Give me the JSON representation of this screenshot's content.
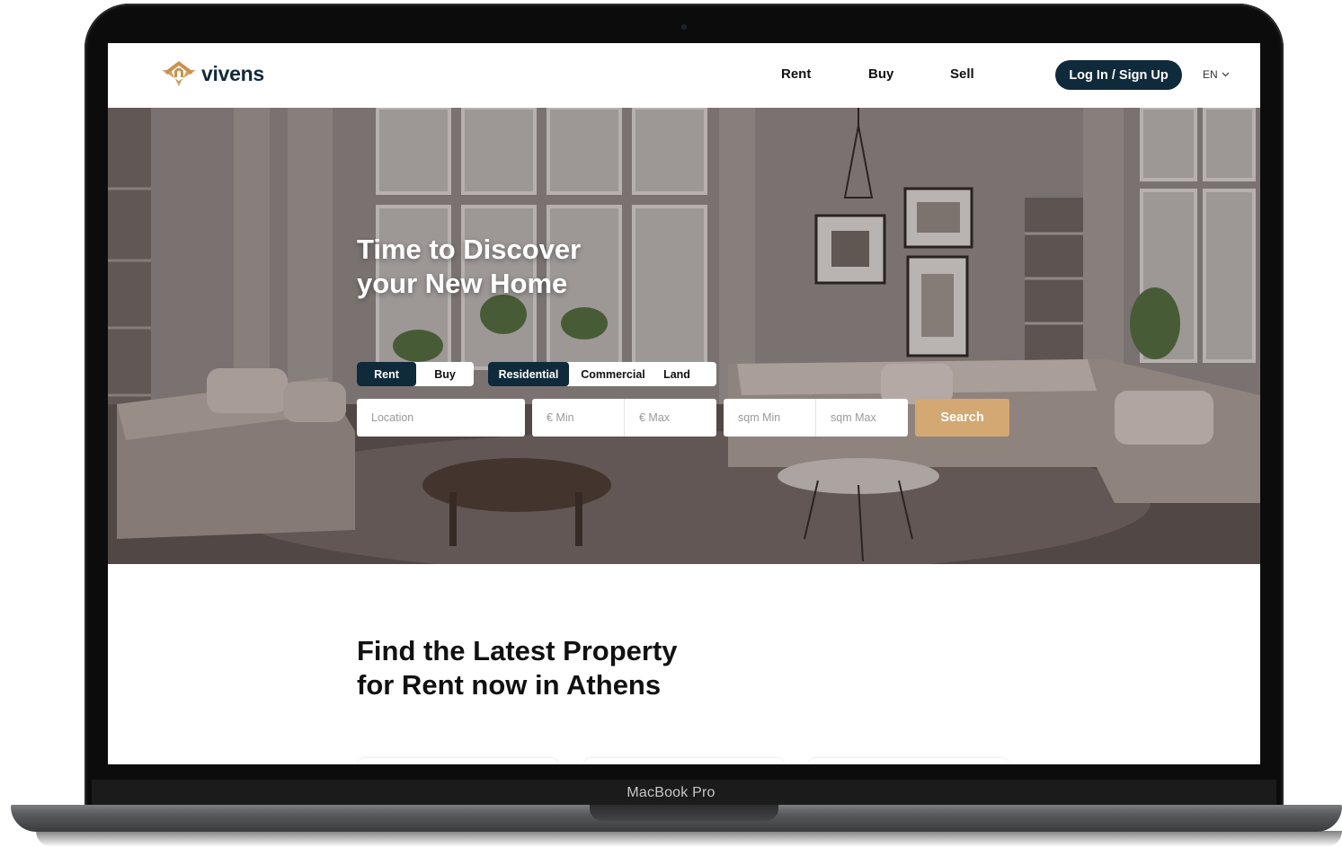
{
  "brand": {
    "name": "vivens"
  },
  "nav": {
    "links": [
      {
        "label": "Rent"
      },
      {
        "label": "Buy"
      },
      {
        "label": "Sell"
      }
    ],
    "login_label": "Log In / Sign Up",
    "language": "EN"
  },
  "hero": {
    "title_line1": "Time to Discover",
    "title_line2": "your New Home",
    "mode_toggle": [
      {
        "label": "Rent",
        "active": true
      },
      {
        "label": "Buy",
        "active": false
      }
    ],
    "type_toggle": [
      {
        "label": "Residential",
        "active": true
      },
      {
        "label": "Commercial",
        "active": false
      },
      {
        "label": "Land",
        "active": false
      }
    ],
    "search": {
      "location_placeholder": "Location",
      "price_min_placeholder": "€ Min",
      "price_max_placeholder": "€ Max",
      "sqm_min_placeholder": "sqm Min",
      "sqm_max_placeholder": "sqm Max",
      "search_label": "Search"
    }
  },
  "section": {
    "title_line1": "Find the Latest Property",
    "title_line2": "for Rent now in Athens"
  },
  "device": {
    "label": "MacBook Pro"
  },
  "colors": {
    "navy": "#0f2a3a",
    "gold": "#d3a873",
    "logo_gold": "#c8924f"
  }
}
